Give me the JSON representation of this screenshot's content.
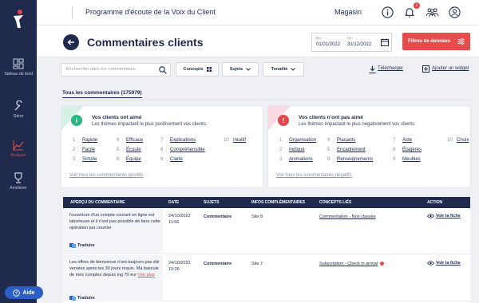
{
  "header": {
    "app_title": "Programme d'écoute de la Voix du Client",
    "store": "Magasin",
    "notif_count": "1"
  },
  "sidebar": {
    "items": [
      {
        "label": "Tableau de bord",
        "icon": "dashboard-icon"
      },
      {
        "label": "Gérer",
        "icon": "wrench-icon"
      },
      {
        "label": "Analyser",
        "icon": "chart-icon",
        "active": true
      },
      {
        "label": "Améliorer",
        "icon": "trophy-icon"
      }
    ],
    "help_label": "Aide"
  },
  "page": {
    "title": "Commentaires clients",
    "date_from_label": "Du",
    "date_from": "01/01/2022",
    "date_to_label": "Au",
    "date_to": "31/12/2022",
    "filter_button": "Filtres de données"
  },
  "toolbar": {
    "search_placeholder": "Rechercher dans les commentaires",
    "concepts": "Concepts",
    "subjects": "Sujets",
    "tonality": "Tonalité",
    "download": "Télécharger",
    "add_widget": "Ajouter un widget"
  },
  "tab": {
    "label": "Tous les commentaires (175979)"
  },
  "positive_card": {
    "title": "Vos clients ont aimé",
    "subtitle": "Les thèmes impactant le plus positivement vos clients.",
    "items": [
      {
        "n": "1",
        "t": "Rapide"
      },
      {
        "n": "2",
        "t": "Facile"
      },
      {
        "n": "3",
        "t": "Simple"
      },
      {
        "n": "4",
        "t": "Efficace"
      },
      {
        "n": "5",
        "t": "Écoute"
      },
      {
        "n": "6",
        "t": "Équipe"
      },
      {
        "n": "7",
        "t": "Explications"
      },
      {
        "n": "8",
        "t": "Compréhensible"
      },
      {
        "n": "9",
        "t": "Clarté"
      },
      {
        "n": "10",
        "t": "Intuitif"
      }
    ],
    "link": "Voir tous les commentaires positifs"
  },
  "negative_card": {
    "title": "Vos clients n'ont pas aimé",
    "subtitle": "Les thèmes impactant le plus négativement vos clients.",
    "items": [
      {
        "n": "1",
        "t": "Organisation"
      },
      {
        "n": "2",
        "t": "Indiqué"
      },
      {
        "n": "3",
        "t": "Animations"
      },
      {
        "n": "4",
        "t": "Placards"
      },
      {
        "n": "5",
        "t": "Encadrement"
      },
      {
        "n": "6",
        "t": "Renseignements"
      },
      {
        "n": "7",
        "t": "Aide"
      },
      {
        "n": "8",
        "t": "Étagères"
      },
      {
        "n": "9",
        "t": "Meubles"
      },
      {
        "n": "10",
        "t": "Choix"
      }
    ],
    "link": "Voir tous les commentaires négatifs"
  },
  "table": {
    "columns": [
      "APERÇU DU COMMENTAIRE",
      "DATE",
      "SUJETS",
      "INFOS COMPLÉMENTAIRES",
      "CONCEPTS LIÉS",
      "ACTION"
    ],
    "rows": [
      {
        "excerpt": "l'ouverture d'un compte courant en ligne est laborieuse et il n'est pas possible de faire cette opération par courrier",
        "more": "",
        "translate": "Traduire",
        "date": "24/10/2022",
        "time": "11:56",
        "subject": "Commentaire",
        "info": "Site 8",
        "concept": "Commentaires - Non classés",
        "concept_dot": false,
        "action": "Voir la fiche"
      },
      {
        "excerpt": "Les offres de bienvenue n'ont toujours pas été versées après les 30 jours requis. Ma bascule de mes comptes depuis ing 70 eur",
        "more": "Voir plus",
        "translate": "Traduire",
        "date": "24/10/2022",
        "time": "10:26",
        "subject": "Commentaire",
        "info": "Site 7",
        "concept": "Subscription - Check in arrival",
        "concept_dot": true,
        "action": "Voir la fiche"
      }
    ]
  },
  "colors": {
    "navy": "#1f2a4d",
    "accent_red": "#e74c4c",
    "positive": "#2fb582",
    "negative": "#e0494b"
  }
}
